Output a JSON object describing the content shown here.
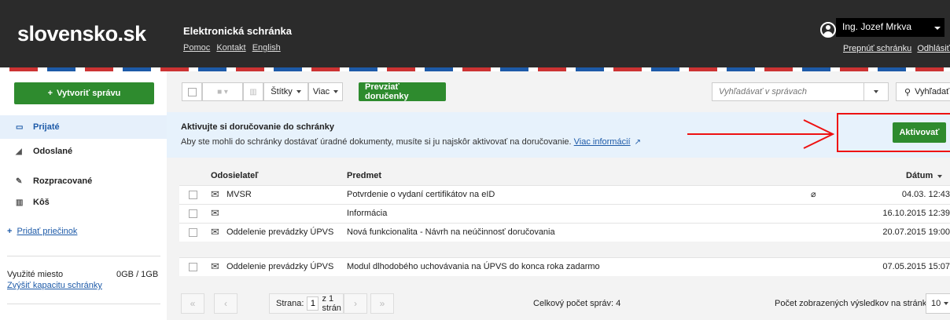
{
  "header": {
    "brand": "slovensko.sk",
    "app_title": "Elektronická schránka",
    "links": [
      "Pomoc",
      "Kontakt",
      "English"
    ],
    "user_name": "Ing. Jozef Mrkva",
    "switch_box": "Prepnúť schránku",
    "logout": "Odhlásiť sa"
  },
  "sidebar": {
    "new_message": "Vytvoriť správu",
    "items": [
      {
        "label": "Prijaté",
        "icon": "inbox-icon"
      },
      {
        "label": "Odoslané",
        "icon": "paper-plane-icon"
      },
      {
        "label": "Rozpracované",
        "icon": "pencil-icon"
      },
      {
        "label": "Kôš",
        "icon": "trash-icon"
      }
    ],
    "add_folder": "Pridať priečinok",
    "space_label": "Využité miesto",
    "space_value": "0GB / 1GB",
    "increase_capacity": "Zvýšiť kapacitu schránky"
  },
  "toolbar": {
    "labels": "Štítky",
    "more": "Viac",
    "receipts": "Prevziať doručenky",
    "search_placeholder": "Vyhľadávať v správach",
    "search_button": "Vyhľadať"
  },
  "banner": {
    "title": "Aktivujte si doručovanie do schránky",
    "text": "Aby ste mohli do schránky dostávať úradné dokumenty, musíte si ju najskôr aktivovať na doručovanie.",
    "link": "Viac informácií",
    "activate": "Aktivovať"
  },
  "table": {
    "headers": {
      "sender": "Odosielateľ",
      "subject": "Predmet",
      "date": "Dátum"
    },
    "rows": [
      {
        "sender": "MVSR",
        "subject": "Potvrdenie o vydaní certifikátov na eID",
        "date": "04.03. 12:43"
      },
      {
        "sender": "",
        "subject": "Informácia",
        "date": "16.10.2015 12:39"
      },
      {
        "sender": "Oddelenie prevádzky ÚPVS",
        "subject": "Nová funkcionalita - Návrh na neúčinnosť doručovania",
        "date": "20.07.2015 19:00"
      },
      {
        "sender": "Oddelenie prevádzky ÚPVS",
        "subject": "Modul dlhodobého uchovávania na ÚPVS do konca roka zadarmo",
        "date": "07.05.2015 15:07"
      }
    ]
  },
  "pager": {
    "page_label": "Strana:",
    "page_value": "1",
    "of_pages": "z 1 strán",
    "total": "Celkový počet správ: 4",
    "per_page_label": "Počet zobrazených výsledkov na stránku:",
    "per_page_value": "10"
  },
  "colors": {
    "green": "#2e8b2e",
    "link": "#1d5aa8",
    "highlight": "#e11111",
    "header": "#2b2b2b"
  }
}
